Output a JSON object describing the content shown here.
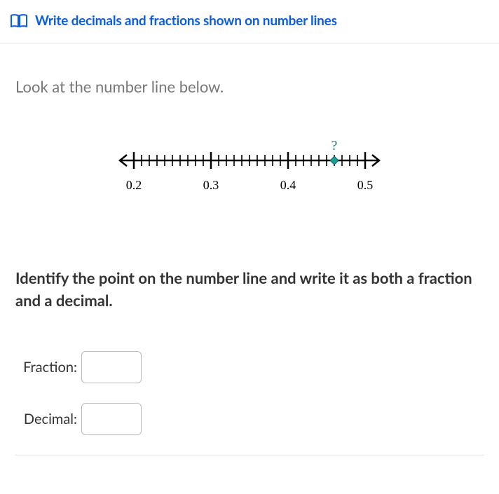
{
  "header": {
    "title": "Write decimals and fractions shown on number lines"
  },
  "instruction": "Look at the number line below.",
  "numberline": {
    "labels": [
      "0.2",
      "0.3",
      "0.4",
      "0.5"
    ],
    "question_marker": "?",
    "point_value": 0.46
  },
  "question": "Identify the point on the number line and write it as both a fraction and a decimal.",
  "answers": {
    "fraction_label": "Fraction:",
    "decimal_label": "Decimal:",
    "fraction_value": "",
    "decimal_value": ""
  }
}
